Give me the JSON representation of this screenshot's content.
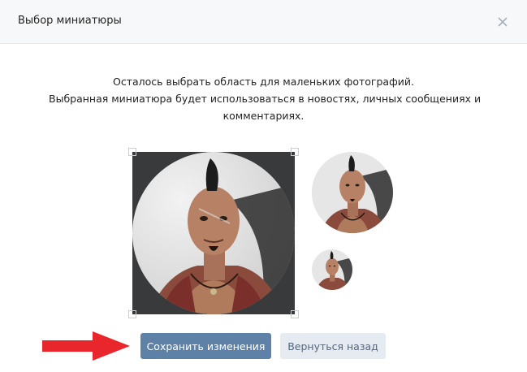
{
  "dialog": {
    "title": "Выбор миниатюры",
    "close_icon": "close-icon"
  },
  "description": {
    "line1": "Осталось выбрать область для маленьких фотографий.",
    "line2": "Выбранная миниатюра будет использоваться в новостях, личных сообщениях и",
    "line3": "комментариях."
  },
  "buttons": {
    "save": "Сохранить изменения",
    "back": "Вернуться назад"
  },
  "colors": {
    "primary_button": "#5e81a8",
    "secondary_button": "#e5ebf1",
    "annotation_arrow": "#e8262c"
  }
}
